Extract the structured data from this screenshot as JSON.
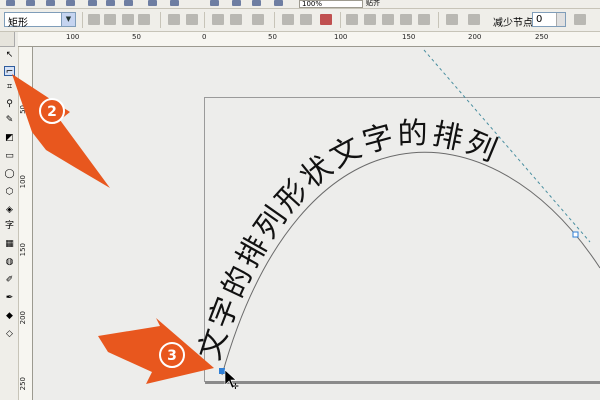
{
  "toolbar": {
    "zoom_value": "100%",
    "wrap_label": "贴齐",
    "shape_select_value": "矩形",
    "reduce_nodes_label": "减少节点",
    "reduce_nodes_value": "0"
  },
  "ruler": {
    "h_labels": [
      "100",
      "50",
      "0",
      "50",
      "100",
      "150",
      "200",
      "250"
    ],
    "v_labels": [
      "50",
      "100",
      "150",
      "200",
      "250"
    ]
  },
  "toolbox": {
    "text_tool_glyph": "字"
  },
  "canvas": {
    "path_text": "文字的排列形状文字的排列"
  },
  "callouts": {
    "step2": "2",
    "step3": "3"
  },
  "colors": {
    "callout_orange": "#e8571e",
    "guide_teal": "#4a8fa0"
  }
}
